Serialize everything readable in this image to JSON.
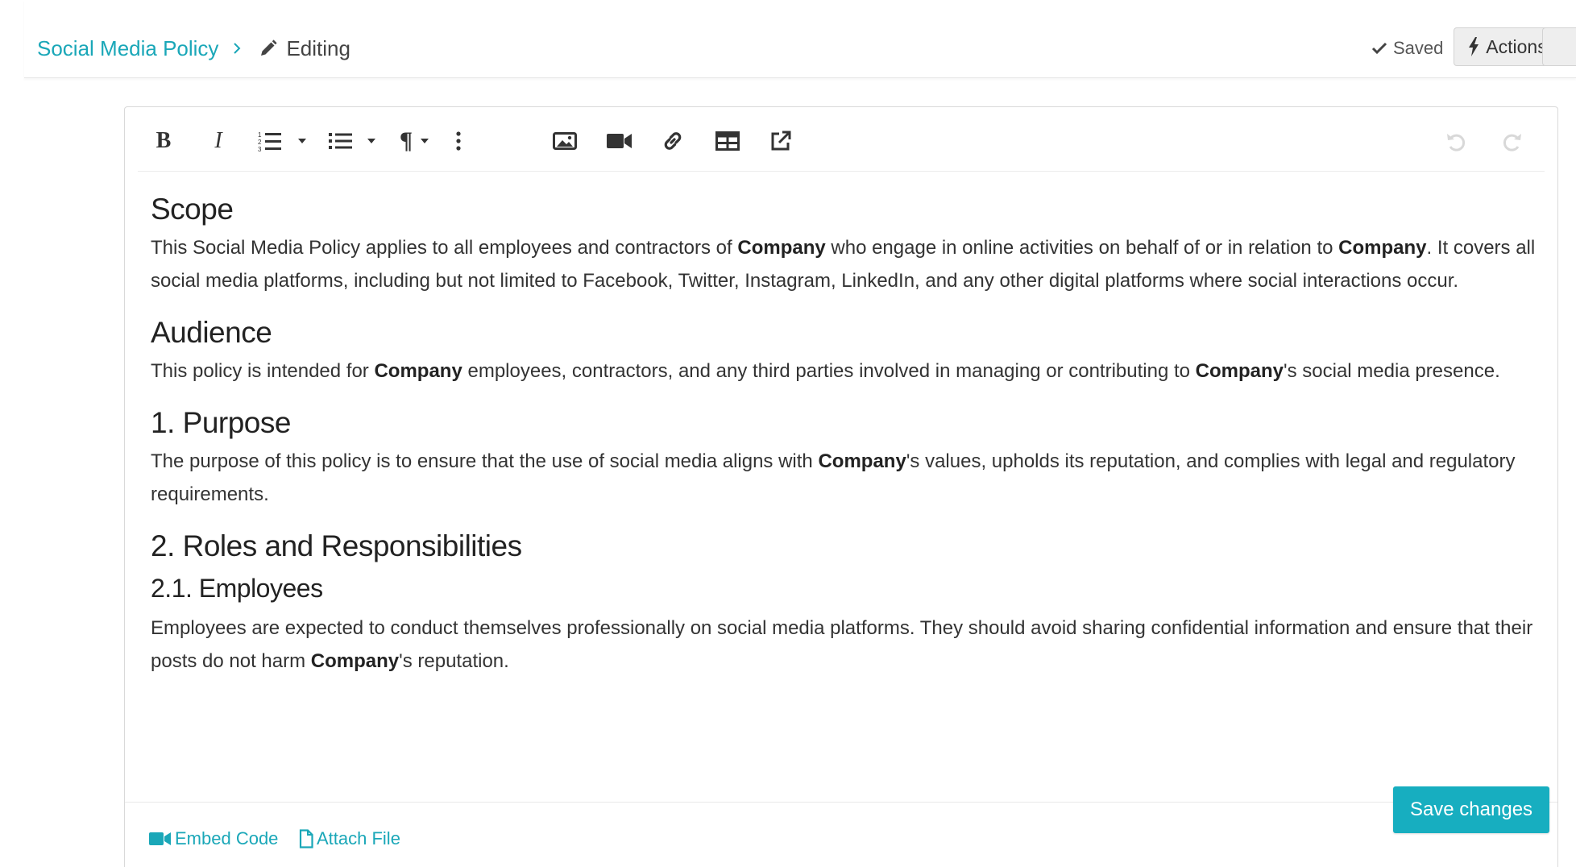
{
  "breadcrumb": {
    "parent": "Social Media Policy",
    "current": "Editing"
  },
  "header": {
    "saved_label": "Saved",
    "actions_label": "Actions"
  },
  "toolbar": {
    "bold_glyph": "B",
    "italic_glyph": "I",
    "paragraph_glyph": "¶"
  },
  "document": {
    "scope_heading": "Scope",
    "scope_p": [
      "This Social Media Policy applies to all employees and contractors of ",
      "Company",
      " who engage in online activities on behalf of or in relation to ",
      "Company",
      ". It covers all social media platforms, including but not limited to Facebook, Twitter, Instagram, LinkedIn, and any other digital platforms where social interactions occur."
    ],
    "audience_heading": "Audience",
    "audience_p": [
      "This policy is intended for ",
      "Company",
      " employees, contractors, and any third parties involved in managing or contributing to ",
      "Company",
      "'s social media presence."
    ],
    "purpose_heading": "1. Purpose",
    "purpose_p": [
      "The purpose of this policy is to ensure that the use of social media aligns with ",
      "Company",
      "'s values, upholds its reputation, and complies with legal and regulatory requirements."
    ],
    "roles_heading": "2. Roles and Responsibilities",
    "employees_heading": "2.1. Employees",
    "employees_p": [
      "Employees are expected to conduct themselves professionally on social media platforms. They should avoid sharing confidential information and ensure that their posts do not harm ",
      "Company",
      "'s reputation."
    ]
  },
  "footer": {
    "embed_label": "Embed Code",
    "attach_label": "Attach File",
    "save_label": "Save changes"
  },
  "colors": {
    "accent": "#17aec0",
    "link": "#1aa7b8"
  }
}
